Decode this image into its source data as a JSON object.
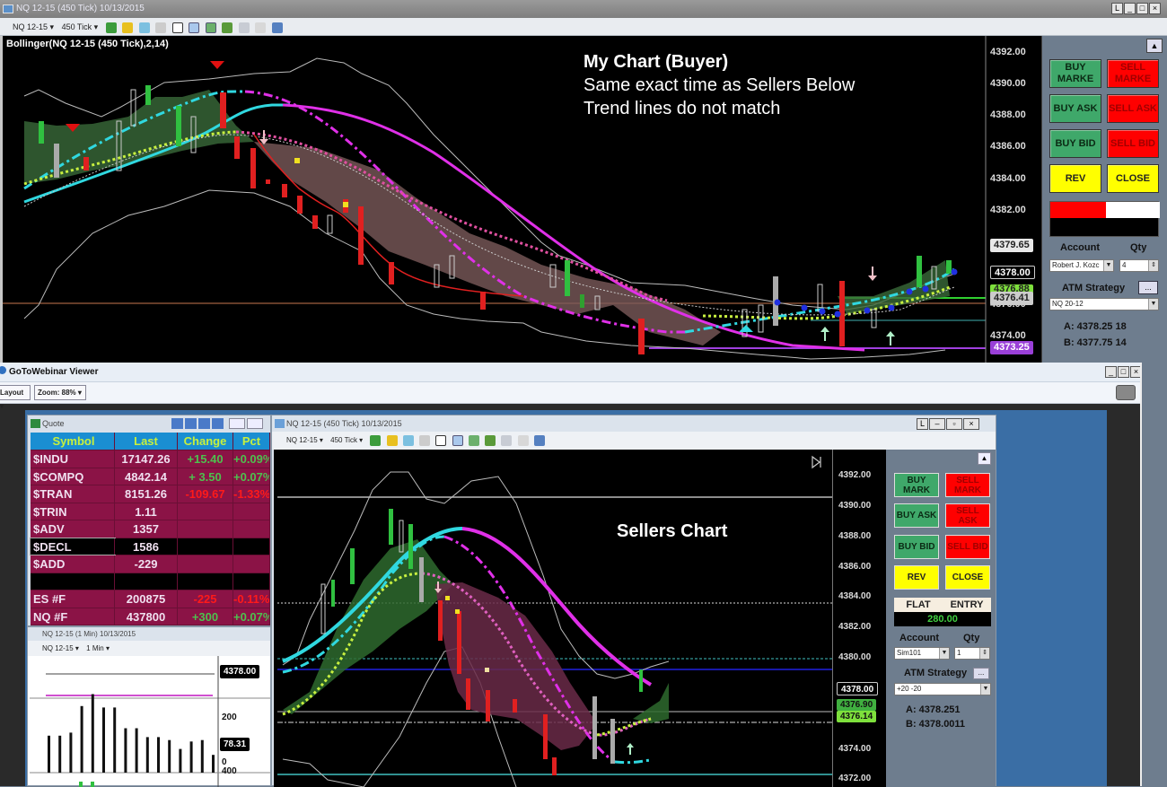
{
  "top_window": {
    "title": "NQ 12-15 (450 Tick)  10/13/2015",
    "window_buttons": [
      "L",
      "_",
      "□",
      "×"
    ],
    "toolbar": {
      "instrument": "NQ 12-15 ▾",
      "interval": "450 Tick ▾"
    },
    "indicator_label": "Bollinger(NQ 12-15 (450 Tick),2,14)",
    "annotation": {
      "line1": "My Chart (Buyer)",
      "line2": "Same exact time as Sellers Below",
      "line3": "Trend   lines do not match"
    },
    "axis_ticks": [
      "4392.00",
      "4390.00",
      "4388.00",
      "4386.00",
      "4384.00",
      "4382.00",
      "4376.00",
      "4374.00"
    ],
    "price_tags": {
      "t1": "4379.65",
      "t2": "4378.00",
      "t3": "4376.88",
      "t4": "4376.41",
      "t5": "4373.25"
    },
    "panel": {
      "buy_market": "BUY MARKE",
      "sell_market": "SELL MARKE",
      "buy_ask": "BUY ASK",
      "sell_ask": "SELL ASK",
      "buy_bid": "BUY BID",
      "sell_bid": "SELL BID",
      "rev": "REV",
      "close": "CLOSE",
      "account_label": "Account",
      "qty_label": "Qty",
      "account_value": "Robert J. Kozc",
      "qty_value": "4",
      "atm_label": "ATM Strategy",
      "atm_btn": "...",
      "atm_value": "NQ 20-12",
      "a_line": "A: 4378.25  18",
      "b_line": "B: 4377.75  14"
    }
  },
  "webinar": {
    "title": "GoToWebinar Viewer",
    "layout_label": "Layout ▾",
    "zoom_label": "Zoom: 88% ▾"
  },
  "quote": {
    "title": "Quote",
    "headers": [
      "Symbol",
      "Last",
      "Change",
      "Pct"
    ],
    "rows": [
      {
        "symbol": "$INDU",
        "last": "17147.26",
        "change": "+15.40",
        "pct": "+0.09%",
        "dir": "up"
      },
      {
        "symbol": "$COMPQ",
        "last": "4842.14",
        "change": "+ 3.50",
        "pct": "+0.07%",
        "dir": "up"
      },
      {
        "symbol": "$TRAN",
        "last": "8151.26",
        "change": "-109.67",
        "pct": "-1.33%",
        "dir": "down"
      },
      {
        "symbol": "$TRIN",
        "last": "1.11",
        "change": "",
        "pct": "",
        "dir": ""
      },
      {
        "symbol": "$ADV",
        "last": "1357",
        "change": "",
        "pct": "",
        "dir": ""
      },
      {
        "symbol": "$DECL",
        "last": "1586",
        "change": "",
        "pct": "",
        "dir": "",
        "selected": true
      },
      {
        "symbol": "$ADD",
        "last": "-229",
        "change": "",
        "pct": "",
        "dir": ""
      },
      {
        "symbol": "",
        "last": "",
        "change": "",
        "pct": "",
        "dir": "",
        "blank": true
      },
      {
        "symbol": "ES #F",
        "last": "200875",
        "change": "-225",
        "pct": "-0.11%",
        "dir": "down"
      },
      {
        "symbol": "NQ #F",
        "last": "437800",
        "change": "+300",
        "pct": "+0.07%",
        "dir": "up"
      }
    ]
  },
  "minute_chart": {
    "title": "NQ 12-15 (1 Min)  10/13/2015",
    "toolbar": {
      "instrument": "NQ 12-15 ▾",
      "interval": "1 Min ▾"
    },
    "price_tag": "4378.00",
    "axis_ticks": [
      "200",
      "0",
      "400"
    ],
    "value_tag": "78.31",
    "bar_values": [
      125,
      125,
      135,
      225,
      265,
      220,
      220,
      150,
      150,
      120,
      120,
      110,
      80,
      105,
      110,
      60
    ]
  },
  "sellers_chart": {
    "title": "NQ 12-15 (450 Tick)  10/13/2015",
    "toolbar": {
      "instrument": "NQ 12-15 ▾",
      "interval": "450 Tick ▾"
    },
    "annotation": "Sellers Chart",
    "axis_ticks": [
      "4392.00",
      "4390.00",
      "4388.00",
      "4386.00",
      "4384.00",
      "4382.00",
      "4380.00",
      "4374.00",
      "4372.00"
    ],
    "price_tags": {
      "t1": "4378.00",
      "t2": "4376.90",
      "t3": "4376.14"
    },
    "panel": {
      "buy_market": "BUY MARK",
      "sell_market": "SELL MARK",
      "buy_ask": "BUY ASK",
      "sell_ask": "SELL ASK",
      "buy_bid": "BUY BID",
      "sell_bid": "SELL BID",
      "rev": "REV",
      "close": "CLOSE",
      "flat": "FLAT",
      "entry": "ENTRY",
      "pnl": "280.00",
      "account_label": "Account",
      "qty_label": "Qty",
      "account_value": "Sim101",
      "qty_value": "1",
      "atm_label": "ATM Strategy",
      "atm_btn": "...",
      "atm_value": "+20 -20",
      "a_line": "A: 4378.251",
      "b_line": "B: 4378.0011"
    }
  },
  "colors": {
    "buy": "#3fa86a",
    "sell": "#ff0000",
    "action": "#ffff00",
    "quote_row": "#8b1346",
    "quote_header": "#1a8ed2",
    "quote_header_text": "#c8f03c",
    "up": "#4ec04e",
    "down": "#ff1a1a",
    "magenta": "#e040e8",
    "cyan": "#40e0e8"
  }
}
